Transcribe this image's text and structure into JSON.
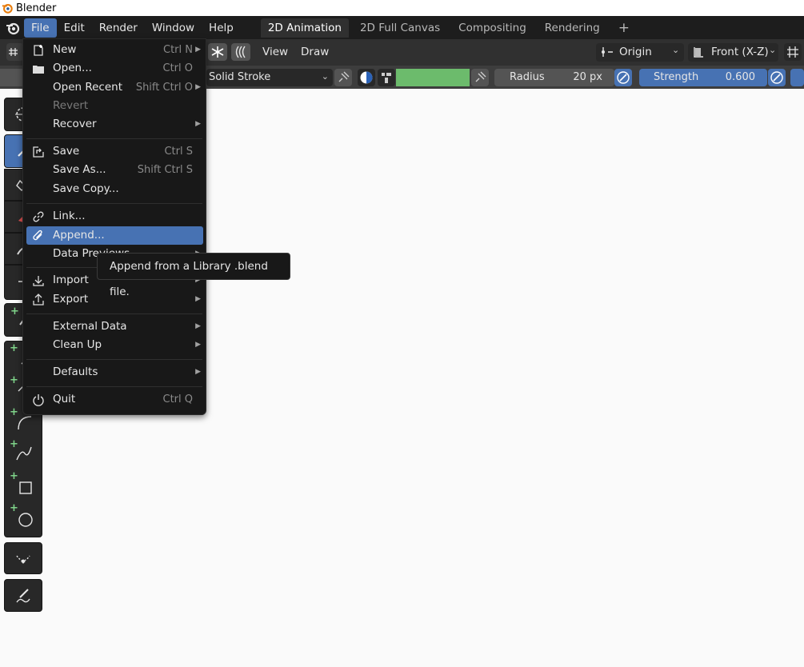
{
  "window": {
    "title": "Blender"
  },
  "topbar": {
    "menus": [
      "File",
      "Edit",
      "Render",
      "Window",
      "Help"
    ],
    "workspaces": [
      "2D Animation",
      "2D Full Canvas",
      "Compositing",
      "Rendering"
    ],
    "add_workspace": "+"
  },
  "header": {
    "view": "View",
    "draw": "Draw",
    "pivot": "Origin",
    "orientation": "Front (X-Z)"
  },
  "tool_settings": {
    "material": "Solid Stroke",
    "color_swatch": "#6cbb6c",
    "radius_label": "Radius",
    "radius_value": "20 px",
    "strength_label": "Strength",
    "strength_value": "0.600",
    "strength_color": "#4772b3"
  },
  "file_menu": {
    "items": [
      {
        "label": "New",
        "shortcut": "Ctrl N",
        "submenu": true,
        "icon": "new-file-icon"
      },
      {
        "label": "Open...",
        "shortcut": "Ctrl O",
        "icon": "folder-icon"
      },
      {
        "label": "Open Recent",
        "shortcut": "Shift Ctrl O",
        "submenu": true
      },
      {
        "label": "Revert",
        "disabled": true
      },
      {
        "label": "Recover",
        "submenu": true
      },
      {
        "label": "Save",
        "shortcut": "Ctrl S",
        "icon": "save-icon"
      },
      {
        "label": "Save As...",
        "shortcut": "Shift Ctrl S"
      },
      {
        "label": "Save Copy..."
      },
      {
        "label": "Link...",
        "icon": "link-icon"
      },
      {
        "label": "Append...",
        "icon": "append-icon",
        "highlighted": true
      },
      {
        "label": "Data Previews",
        "submenu": true
      },
      {
        "label": "Import",
        "submenu": true,
        "icon": "import-icon"
      },
      {
        "label": "Export",
        "submenu": true,
        "icon": "export-icon"
      },
      {
        "label": "External Data",
        "submenu": true
      },
      {
        "label": "Clean Up",
        "submenu": true
      },
      {
        "label": "Defaults",
        "submenu": true
      },
      {
        "label": "Quit",
        "shortcut": "Ctrl Q",
        "icon": "power-icon"
      }
    ]
  },
  "tooltip": {
    "text": "Append from a Library .blend file."
  },
  "colors": {
    "accent": "#4772b3",
    "menu_bg": "#181818",
    "canvas": "#fafafa"
  }
}
